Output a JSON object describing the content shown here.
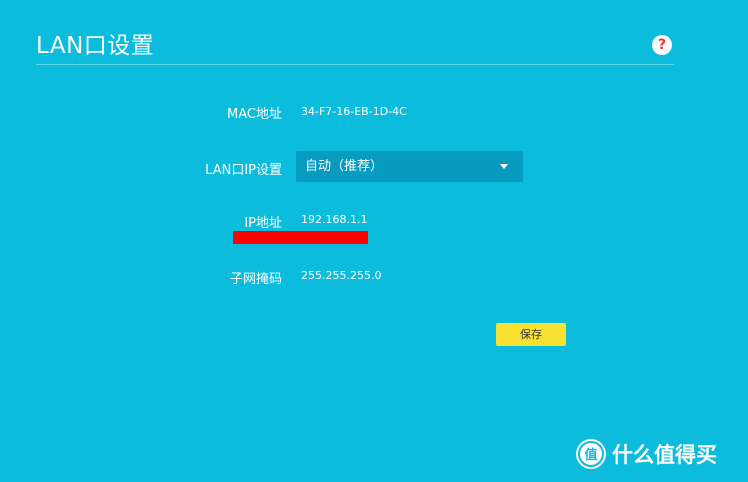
{
  "page": {
    "title": "LAN口设置",
    "help_symbol": "?"
  },
  "fields": {
    "mac": {
      "label": "MAC地址",
      "value": "34-F7-16-EB-1D-4C"
    },
    "lan_ip_setting": {
      "label": "LAN口IP设置",
      "selected": "自动（推荐）"
    },
    "ip": {
      "label": "IP地址",
      "value": "192.168.1.1"
    },
    "subnet_mask": {
      "label": "子网掩码",
      "value": "255.255.255.0"
    }
  },
  "actions": {
    "save_label": "保存"
  },
  "watermark": {
    "text": "什么值得买"
  },
  "colors": {
    "background": "#0bbcdd",
    "select_background": "#079bc0",
    "save_button": "#f7e131",
    "redaction": "#ff0000",
    "help_icon_mark": "#e33b3b"
  },
  "icons": {
    "help": "question-circle-icon",
    "dropdown": "chevron-down-icon",
    "watermark_logo": "smzdm-logo-icon"
  }
}
